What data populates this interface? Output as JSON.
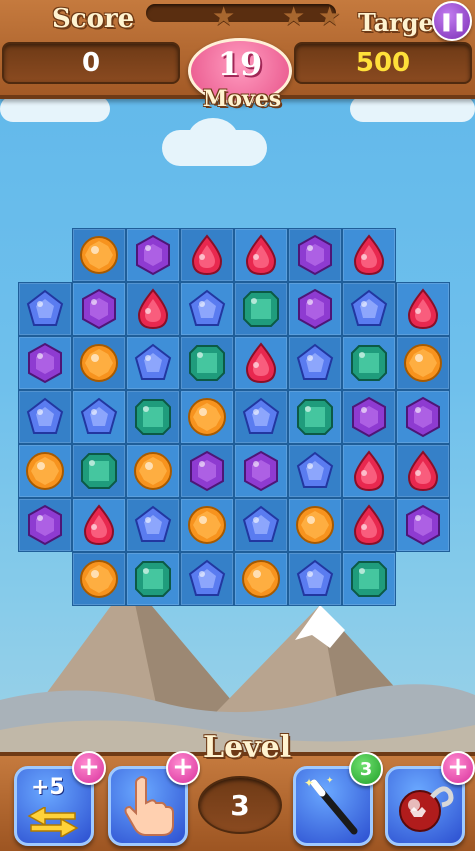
{
  "header": {
    "score_label": "Score",
    "score_value": "0",
    "target_label": "Target",
    "target_value": "500",
    "moves_value": "19",
    "moves_label": "Moves",
    "pause_icon": "pause-icon",
    "stars_earned": 0,
    "stars_total": 3
  },
  "footer": {
    "level_label": "Level",
    "level_value": "3",
    "booster_plus5_label": "+5",
    "booster_plus5_icon": "swap-arrows-icon",
    "booster_hand_icon": "hand-pointer-icon",
    "booster_wand_icon": "magic-wand-icon",
    "booster_wand_count": "3",
    "booster_bomb_icon": "bomb-icon",
    "add_icon": "+"
  },
  "colors": {
    "orange": "#f7931e",
    "purple": "#8e3bd1",
    "red": "#e8284f",
    "blue": "#5a7cf0",
    "green": "#1f9c7c"
  },
  "board": {
    "rows": [
      [
        null,
        "orange",
        "purple",
        "red",
        "red",
        "purple",
        "red",
        null
      ],
      [
        "blue",
        "purple",
        "red",
        "blue",
        "green",
        "purple",
        "blue",
        "red"
      ],
      [
        "purple",
        "orange",
        "blue",
        "green",
        "red",
        "blue",
        "green",
        "orange"
      ],
      [
        "blue",
        "blue",
        "green",
        "orange",
        "blue",
        "green",
        "purple",
        "purple"
      ],
      [
        "orange",
        "green",
        "orange",
        "purple",
        "purple",
        "blue",
        "red",
        "red"
      ],
      [
        "purple",
        "red",
        "blue",
        "orange",
        "blue",
        "orange",
        "red",
        "purple"
      ],
      [
        null,
        "orange",
        "green",
        "blue",
        "orange",
        "blue",
        "green",
        null
      ]
    ]
  }
}
